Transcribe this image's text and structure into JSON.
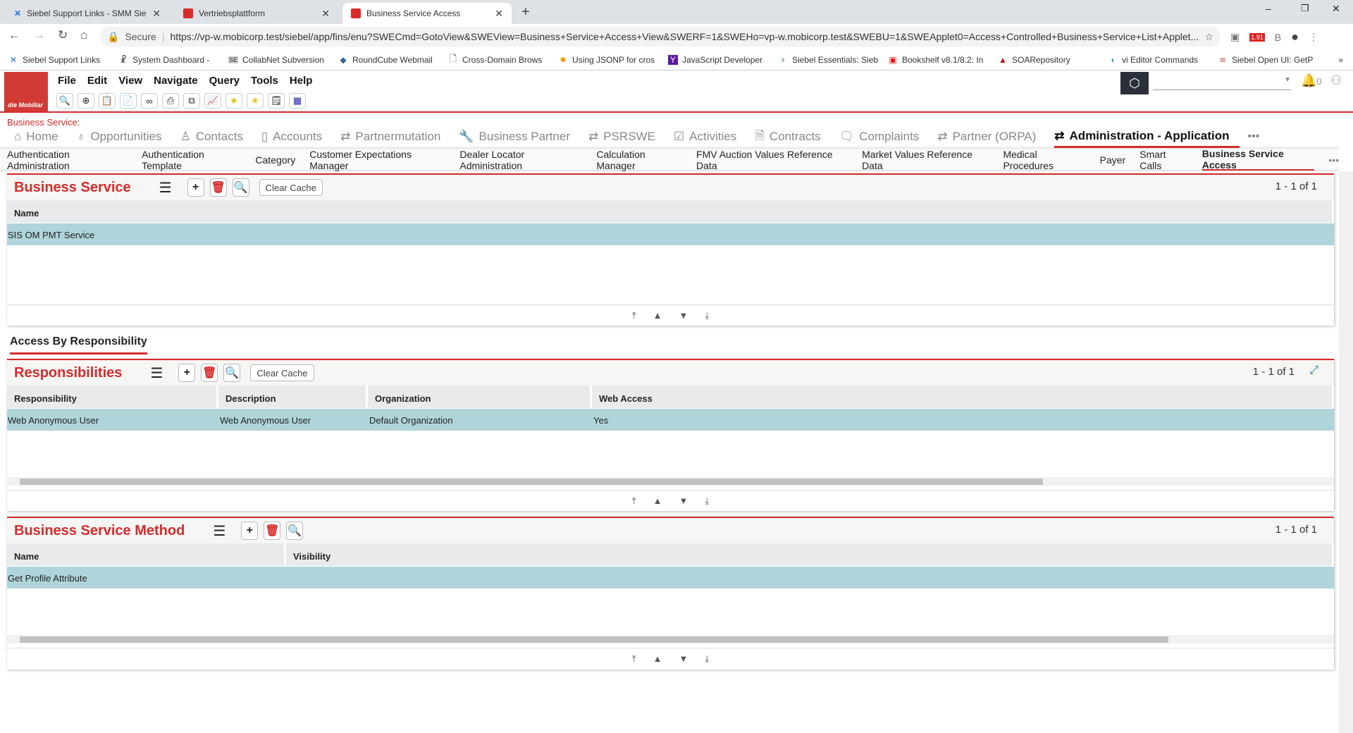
{
  "browser": {
    "tabs": [
      {
        "label": "Siebel Support Links - SMM Siebel",
        "icon": "siebel-x-icon"
      },
      {
        "label": "Vertriebsplattform",
        "icon": "doc-red-icon"
      },
      {
        "label": "Business Service Access",
        "icon": "doc-red-icon",
        "active": true
      }
    ],
    "secure_label": "Secure",
    "url": "https://vp-w.mobicorp.test/siebel/app/fins/enu?SWECmd=GotoView&SWEView=Business+Service+Access+View&SWERF=1&SWEHo=vp-w.mobicorp.test&SWEBU=1&SWEApplet0=Access+Controlled+Business+Service+List+Applet...",
    "ext_badge": "1.91",
    "bookmarks": [
      "Siebel Support Links",
      "System Dashboard -",
      "CollabNet Subversion",
      "RoundCube Webmail",
      "Cross-Domain Brows",
      "Using JSONP for cros",
      "JavaScript Developer",
      "Siebel Essentials: Sieb",
      "Bookshelf v8.1/8.2: In",
      "SOARepository",
      "vi Editor Commands",
      "Siebel Open UI: GetP"
    ]
  },
  "app": {
    "logo": "die Mobiliar",
    "menu": [
      "File",
      "Edit",
      "View",
      "Navigate",
      "Query",
      "Tools",
      "Help"
    ],
    "notif_count": "0",
    "context_label": "Business Service:",
    "screens": [
      "Home",
      "Opportunities",
      "Contacts",
      "Accounts",
      "Partnermutation",
      "Business Partner",
      "PSRSWE",
      "Activities",
      "Contracts",
      "Complaints",
      "Partner (ORPA)",
      "Administration - Application"
    ],
    "views": [
      "Authentication Administration",
      "Authentication Template",
      "Category",
      "Customer Expectations Manager",
      "Dealer Locator Administration",
      "Calculation Manager",
      "FMV Auction Values Reference Data",
      "Market Values Reference Data",
      "Medical Procedures",
      "Payer",
      "Smart Calls",
      "Business Service Access"
    ],
    "accent": "#d62b2b",
    "selected_row": "#afd5db"
  },
  "bs": {
    "title": "Business Service",
    "clear": "Clear Cache",
    "count": "1 - 1 of 1",
    "cols": [
      "Name"
    ],
    "rows": [
      [
        "SIS OM PMT Service"
      ]
    ]
  },
  "subview": "Access By Responsibility",
  "resp": {
    "title": "Responsibilities",
    "clear": "Clear Cache",
    "count": "1 - 1 of 1",
    "cols": [
      "Responsibility",
      "Description",
      "Organization",
      "Web Access"
    ],
    "rows": [
      [
        "Web Anonymous User",
        "Web Anonymous User",
        "Default Organization",
        "Yes"
      ]
    ]
  },
  "bsm": {
    "title": "Business Service Method",
    "count": "1 - 1 of 1",
    "cols": [
      "Name",
      "Visibility"
    ],
    "rows": [
      [
        "Get Profile Attribute",
        ""
      ]
    ]
  }
}
